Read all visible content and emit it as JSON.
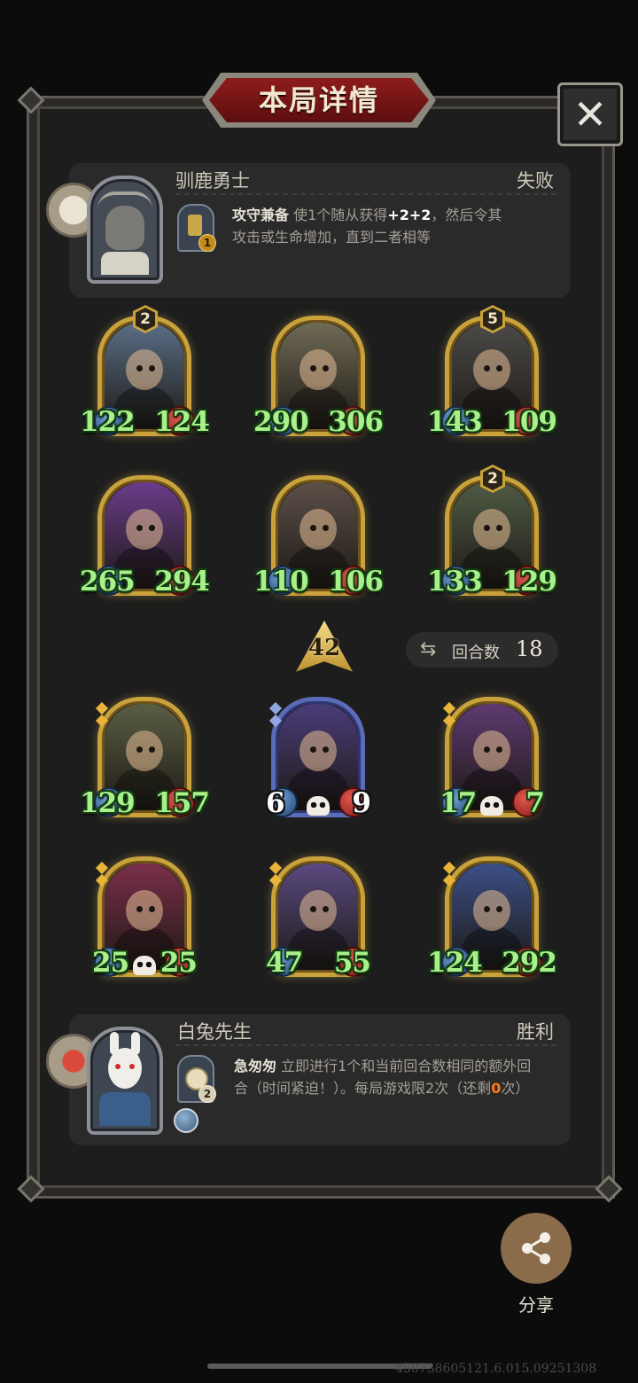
{
  "header": {
    "title": "本局详情",
    "close_icon": "close-icon"
  },
  "opponent": {
    "name": "驯鹿勇士",
    "result": "失败",
    "skill_level": "1",
    "skill_name": "攻守兼备",
    "skill_text_1": "使1个随从获得",
    "skill_bonus": "+2+2",
    "skill_text_2": "，然后令其",
    "skill_line_2": "攻击或生命增加，直到二者相等"
  },
  "opponent_minions": [
    {
      "tier": "2",
      "attack": "122",
      "health": "124",
      "theme": "#5a6e86"
    },
    {
      "tier": "",
      "attack": "290",
      "health": "306",
      "theme": "#6f6a55"
    },
    {
      "tier": "5",
      "attack": "143",
      "health": "109",
      "theme": "#4b4a48"
    },
    {
      "tier": "",
      "attack": "265",
      "health": "294",
      "theme": "#6a3c8a"
    },
    {
      "tier": "",
      "attack": "110",
      "health": "106",
      "theme": "#5c5048"
    },
    {
      "tier": "2",
      "attack": "133",
      "health": "129",
      "theme": "#4f5a44"
    }
  ],
  "center": {
    "level": "42",
    "rounds_label": "回合数",
    "rounds_value": "18",
    "rounds_icon": "cycle-icon"
  },
  "player_minions": [
    {
      "attack": "129",
      "health": "157",
      "theme": "#5a5e44",
      "style": "gold",
      "skull": false,
      "white": false
    },
    {
      "attack": "6",
      "health": "9",
      "theme": "#4a3c78",
      "style": "blue",
      "skull": true,
      "white": true
    },
    {
      "attack": "17",
      "health": "7",
      "theme": "#5d3a70",
      "style": "gold",
      "skull": true,
      "white": false
    },
    {
      "attack": "25",
      "health": "25",
      "theme": "#7a2f4a",
      "style": "gold",
      "skull": true,
      "white": false
    },
    {
      "attack": "47",
      "health": "55",
      "theme": "#5a4a80",
      "style": "gold",
      "skull": false,
      "white": false
    },
    {
      "attack": "124",
      "health": "292",
      "theme": "#3b4f86",
      "style": "gold",
      "skull": false,
      "white": false
    }
  ],
  "player": {
    "name": "白兔先生",
    "result": "胜利",
    "skill_level": "2",
    "skill_name": "急匆匆",
    "skill_line_1": "立即进行1个和当前回合数相同的额外回",
    "skill_line_2a": "合（时间紧迫！）。每局游戏限2次（还剩",
    "skill_remaining": "0",
    "skill_line_2b": "次）"
  },
  "share": {
    "label": "分享",
    "icon": "share-icon"
  },
  "footer": {
    "id": "450738605121.6.015.09251308"
  }
}
